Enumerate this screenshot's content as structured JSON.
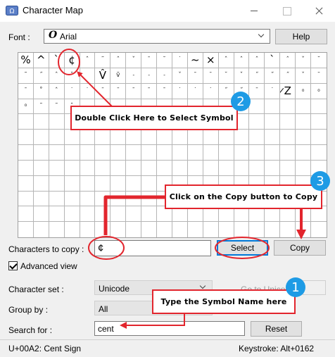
{
  "window": {
    "title": "Character Map"
  },
  "font_row": {
    "label": "Font :",
    "selected": "Arial",
    "help_label": "Help"
  },
  "grid": {
    "rows": [
      [
        "%",
        "^",
        "`",
        "¢",
        "ˆ",
        "˜",
        "ˆ",
        "ˇ",
        "ˉ",
        "˘",
        "˙",
        "~",
        "×",
        "ˆ",
        "ˆ",
        "ˆ",
        "`",
        "ˆ",
        "ˇ",
        "˘"
      ],
      [
        "˜",
        "˝",
        "ˆ",
        "ˇ",
        "",
        "V̂",
        "ṽ",
        "˗",
        "˗",
        "˗",
        "ˇ",
        "ˉ",
        "ˉ",
        "˘",
        "ˇ",
        "˝",
        "˝",
        "˝",
        "ˇ",
        "ˉ"
      ],
      [
        "ˉ",
        "˚",
        "ˆ",
        "˙",
        "˙",
        "ˉ",
        "ˉ",
        "ˉ",
        "ˉ",
        "ˉ",
        "˙",
        "˙",
        "˙",
        "˝",
        "˝",
        "ˉ",
        "˙",
        "̷Z",
        "ͦ",
        "ͦ"
      ],
      [
        "ͦ",
        "˜",
        "˜",
        "ˆ",
        "",
        "",
        "",
        "",
        "",
        "",
        "",
        "",
        "",
        "",
        "",
        "",
        "",
        "",
        "",
        ""
      ]
    ]
  },
  "chars_to_copy": {
    "label": "Characters to copy :",
    "value": "¢",
    "select_label": "Select",
    "copy_label": "Copy"
  },
  "advanced_view": {
    "label": "Advanced view",
    "checked": true
  },
  "character_set": {
    "label": "Character set :",
    "value": "Unicode",
    "goto_label": "Go to Unicode :"
  },
  "group_by": {
    "label": "Group by :",
    "value": "All"
  },
  "search": {
    "label": "Search for :",
    "value": "cent",
    "reset_label": "Reset"
  },
  "status": {
    "left": "U+00A2: Cent Sign",
    "right": "Keystroke: Alt+0162"
  },
  "annotations": {
    "callout1": "Type the Symbol Name here",
    "callout2": "Double Click Here to Select Symbol",
    "callout3": "Click on the Copy button to Copy",
    "badge1": "1",
    "badge2": "2",
    "badge3": "3"
  },
  "colors": {
    "annotation_red": "#e2252d",
    "badge_blue": "#1e9be5",
    "focus_blue": "#0078d7"
  }
}
